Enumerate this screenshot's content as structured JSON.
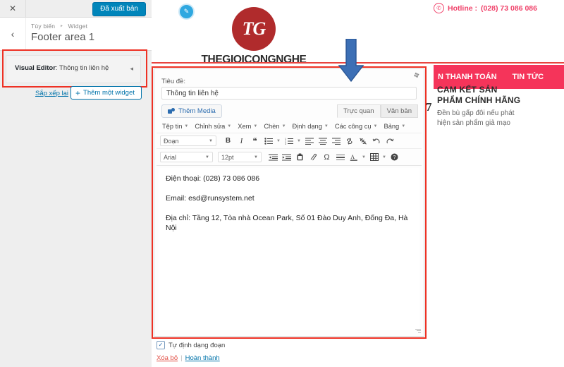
{
  "customizer": {
    "close_icon": "close-icon",
    "publish_label": "Đã xuất bản",
    "back_icon": "chevron-left-icon",
    "breadcrumb": {
      "root": "Tùy biến",
      "separator": "‣",
      "current": "Widget"
    },
    "panel_title": "Footer area 1",
    "widget": {
      "prefix": "Visual Editor",
      "separator": ": ",
      "name": "Thông tin liên hệ",
      "collapse_icon": "chevron-left-icon"
    },
    "reorder_label": "Sắp xếp lại",
    "add_widget_label": "Thêm một widget",
    "add_widget_icon": "plus-icon"
  },
  "editor": {
    "drag_icon": "drag-handle-icon",
    "title_label": "Tiêu đề:",
    "title_value": "Thông tin liên hệ",
    "title_placeholder": "Tiêu đề",
    "add_media_label": "Thêm Media",
    "add_media_icon": "media-icon",
    "tabs": [
      {
        "label": "Trực quan",
        "active": true
      },
      {
        "label": "Văn bản",
        "active": false
      }
    ],
    "menubar": [
      "Tệp tin",
      "Chỉnh sửa",
      "Xem",
      "Chèn",
      "Định dạng",
      "Các công cụ",
      "Bảng"
    ],
    "format_select": "Đoạn",
    "font_select": "Arial",
    "size_select": "12pt",
    "toolbar_row2": [
      "bold-icon",
      "italic-icon",
      "blockquote-icon",
      "bullet-list-icon",
      "bullet-list-caret",
      "numbered-list-icon",
      "numbered-list-caret",
      "align-left-icon",
      "align-center-icon",
      "align-right-icon",
      "link-icon",
      "unlink-icon",
      "undo-icon",
      "redo-icon"
    ],
    "toolbar_row3": [
      "outdent-icon",
      "indent-icon",
      "paste-icon",
      "clear-format-icon",
      "special-char-icon",
      "horizontal-rule-icon",
      "text-color-icon",
      "text-color-caret",
      "table-icon",
      "table-caret",
      "help-icon"
    ],
    "content": [
      "Điện thoại: (028) 73 086 086",
      "Email: esd@runsystem.net",
      "Địa chỉ: Tầng 12, Tòa nhà Ocean Park, Số 01 Đào Duy Anh, Đống Đa, Hà Nội"
    ],
    "autoformat_label": "Tự định dạng đoạn",
    "autoformat_checked": true,
    "delete_label": "Xóa bỏ",
    "links_separator": "|",
    "done_label": "Hoàn thành"
  },
  "preview": {
    "hotline_icon": "phone-icon",
    "hotline_label": "Hotline :",
    "hotline_number": "(028) 73 086 086",
    "logo_monogram": "TG",
    "logo_text": "THEGIOICONGNGHE",
    "edit_icon": "pencil-icon",
    "nav_items": [
      "N THANH TOÁN",
      "TIN TỨC"
    ],
    "promo_number": "7",
    "promo_heading": "CAM KẾT SẢN PHẨM CHÍNH HÃNG",
    "promo_body": "Đền bù gấp đôi nếu phát hiện sản phẩm giả mạo",
    "product_image": "smartphone-product-image"
  },
  "annotation": {
    "arrow": "blue-down-arrow"
  },
  "colors": {
    "publish_blue": "#0085ba",
    "highlight_red": "#ee3124",
    "brand_red": "#b02b2c",
    "nav_pink": "#f5345a",
    "hotline_pink": "#f0426a",
    "link_blue": "#0073aa",
    "arrow_blue": "#3c6fb5"
  }
}
